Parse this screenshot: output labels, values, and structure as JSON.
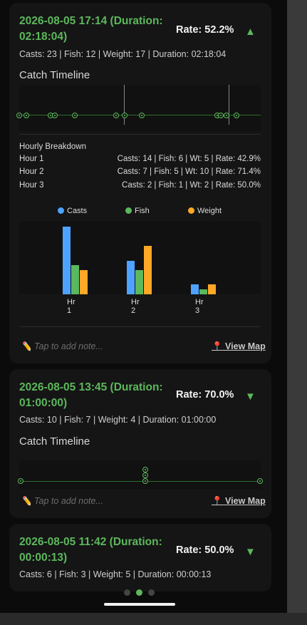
{
  "sessions": [
    {
      "title": "2026-08-05 17:14 (Duration: 02:18:04)",
      "rate": "Rate: 52.2%",
      "trend_icon": "triangle-up",
      "summary": "Casts: 23 | Fish: 12 | Weight: 17 | Duration: 02:18:04",
      "timeline_title": "Catch Timeline",
      "hourly_title": "Hourly Breakdown",
      "hours": [
        {
          "label": "Hour 1",
          "stats": "Casts: 14 | Fish: 6 | Wt: 5 | Rate: 42.9%"
        },
        {
          "label": "Hour 2",
          "stats": "Casts: 7 | Fish: 5 | Wt: 10 | Rate: 71.4%"
        },
        {
          "label": "Hour 3",
          "stats": "Casts: 2 | Fish: 1 | Wt: 2 | Rate: 50.0%"
        }
      ],
      "note_placeholder": "✏️ Tap to add note...",
      "map_label": "📍 View Map"
    },
    {
      "title": "2026-08-05 13:45 (Duration: 01:00:00)",
      "rate": "Rate: 70.0%",
      "trend_icon": "triangle-down",
      "summary": "Casts: 10 | Fish: 7 | Weight: 4 | Duration: 01:00:00",
      "timeline_title": "Catch Timeline",
      "note_placeholder": "✏️ Tap to add note...",
      "map_label": "📍 View Map"
    },
    {
      "title": "2026-08-05 11:42 (Duration: 00:00:13)",
      "rate": "Rate: 50.0%",
      "trend_icon": "triangle-down",
      "summary": "Casts: 6 | Fish: 3 | Weight: 5 | Duration: 00:00:13"
    }
  ],
  "chart_data": {
    "type": "bar",
    "categories": [
      "Hr 1",
      "Hr 2",
      "Hr 3"
    ],
    "series": [
      {
        "name": "Casts",
        "values": [
          14,
          7,
          2
        ],
        "color": "#4da3ff"
      },
      {
        "name": "Fish",
        "values": [
          6,
          5,
          1
        ],
        "color": "#5cb85c"
      },
      {
        "name": "Weight",
        "values": [
          5,
          10,
          2
        ],
        "color": "#ffa726"
      }
    ],
    "legend": "top",
    "grid": false
  },
  "pager": {
    "count": 3,
    "active": 1
  },
  "colors": {
    "accent": "#5cb85c",
    "casts": "#4da3ff",
    "fish": "#5cb85c",
    "weight": "#ffa726"
  }
}
